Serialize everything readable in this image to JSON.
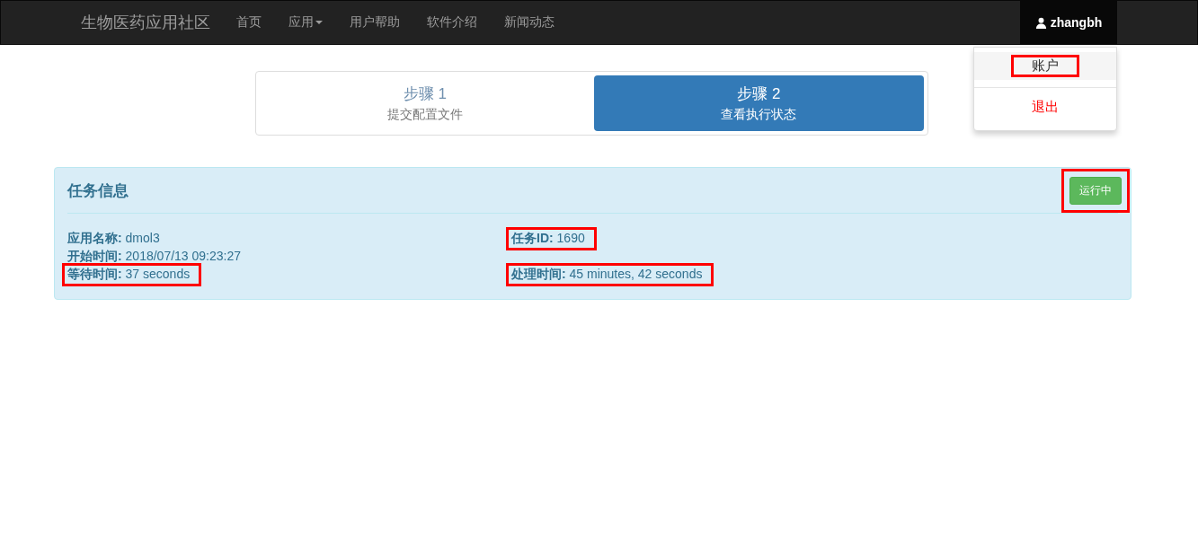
{
  "navbar": {
    "brand": "生物医药应用社区",
    "items": [
      {
        "label": "首页",
        "dropdown": false
      },
      {
        "label": "应用",
        "dropdown": true
      },
      {
        "label": "用户帮助",
        "dropdown": false
      },
      {
        "label": "软件介绍",
        "dropdown": false
      },
      {
        "label": "新闻动态",
        "dropdown": false
      }
    ],
    "user": {
      "name": "zhangbh",
      "expanded": true
    }
  },
  "user_menu": [
    {
      "label": "账户",
      "kind": "item",
      "highlighted": true
    },
    {
      "label": "退出",
      "kind": "danger",
      "highlighted": false
    }
  ],
  "steps": [
    {
      "title": "步骤 1",
      "subtitle": "提交配置文件",
      "selected": false
    },
    {
      "title": "步骤 2",
      "subtitle": "查看执行状态",
      "selected": true
    }
  ],
  "panel": {
    "title": "任务信息",
    "status": {
      "label": "运行中",
      "highlighted": true
    },
    "rows": [
      {
        "left": {
          "text": "**应用名称:** dmol3",
          "highlighted": false
        },
        "right": {
          "text": "**任务ID:** 1690",
          "highlighted": true
        }
      },
      {
        "left": {
          "text": "**开始时间:** 2018/07/13 09:23:27",
          "highlighted": false
        }
      },
      {
        "left": {
          "text": "**等待时间:** 37 seconds",
          "highlighted": true
        },
        "right": {
          "text": "**处理时间:** 45 minutes, 42 seconds",
          "highlighted": true
        }
      }
    ]
  }
}
